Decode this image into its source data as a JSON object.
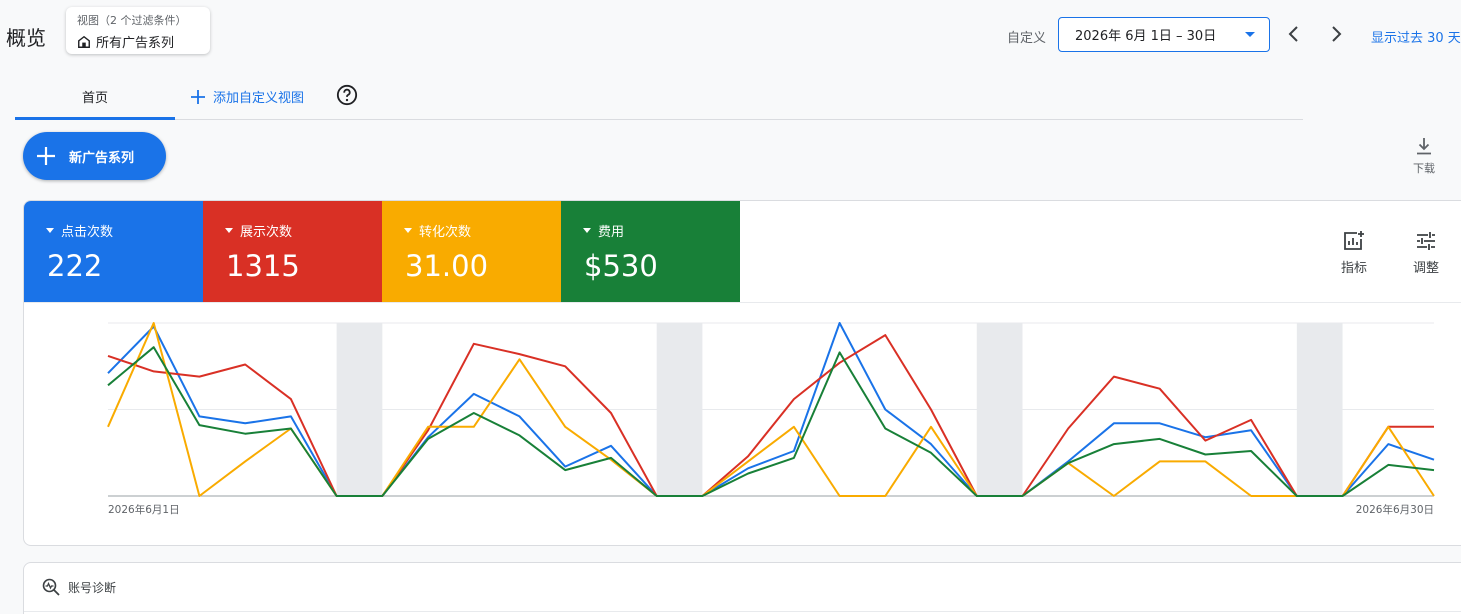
{
  "header": {
    "title": "概览",
    "view_sub": "视图（2 个过滤条件）",
    "view_main": "所有广告系列",
    "custom_label": "自定义",
    "date_range": "2026年 6月 1日 – 30日",
    "show_past": "显示过去 30 天"
  },
  "tabs": {
    "home": "首页",
    "add_view": "添加自定义视图"
  },
  "new_campaign": "新广告系列",
  "download": "下载",
  "metrics": [
    {
      "label": "点击次数",
      "value": "222",
      "color": "#1a73e8"
    },
    {
      "label": "展示次数",
      "value": "1315",
      "color": "#d93025"
    },
    {
      "label": "转化次数",
      "value": "31.00",
      "color": "#f9ab00"
    },
    {
      "label": "费用",
      "value": "$530",
      "color": "#188038"
    }
  ],
  "tools": {
    "metrics": "指标",
    "adjust": "调整"
  },
  "chart_data": {
    "type": "line",
    "x_start_label": "2026年6月1日",
    "x_end_label": "2026年6月30日",
    "weekend_bands": [
      6,
      13,
      20,
      27
    ],
    "series": [
      {
        "key": "clicks",
        "color": "#1a73e8",
        "values": [
          0.71,
          0.98,
          0.46,
          0.42,
          0.46,
          0,
          0,
          0.34,
          0.59,
          0.46,
          0.17,
          0.29,
          0,
          0,
          0.16,
          0.26,
          1.0,
          0.5,
          0.3,
          0,
          0,
          0.2,
          0.42,
          0.42,
          0.34,
          0.38,
          0,
          0,
          0.3,
          0.21
        ]
      },
      {
        "key": "impressions",
        "color": "#d93025",
        "values": [
          0.81,
          0.72,
          0.69,
          0.76,
          0.56,
          0,
          0,
          0.38,
          0.88,
          0.82,
          0.75,
          0.48,
          0,
          0,
          0.23,
          0.56,
          0.77,
          0.93,
          0.5,
          0,
          0,
          0.39,
          0.69,
          0.62,
          0.32,
          0.44,
          0,
          0,
          0.4,
          0.4
        ]
      },
      {
        "key": "conversions",
        "color": "#f9ab00",
        "values": [
          0.4,
          1.0,
          0,
          0.2,
          0.39,
          0,
          0,
          0.4,
          0.4,
          0.79,
          0.4,
          0.21,
          0,
          0,
          0.2,
          0.4,
          0,
          0,
          0.4,
          0,
          0,
          0.19,
          0,
          0.2,
          0.2,
          0,
          0,
          0,
          0.4,
          0
        ]
      },
      {
        "key": "cost",
        "color": "#188038",
        "values": [
          0.64,
          0.86,
          0.41,
          0.36,
          0.39,
          0,
          0,
          0.33,
          0.48,
          0.35,
          0.15,
          0.22,
          0,
          0,
          0.13,
          0.22,
          0.83,
          0.39,
          0.25,
          0,
          0,
          0.19,
          0.3,
          0.33,
          0.24,
          0.26,
          0,
          0,
          0.18,
          0.15
        ]
      }
    ]
  },
  "diagnosis": {
    "title": "账号诊断"
  }
}
